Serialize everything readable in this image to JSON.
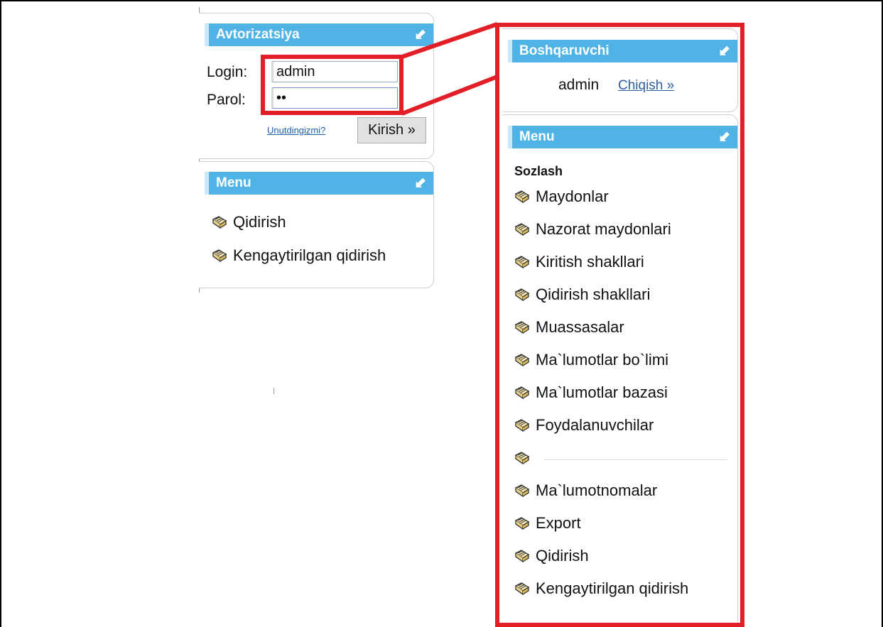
{
  "auth_panel": {
    "title": "Avtorizatsiya",
    "login_label": "Login:",
    "login_value": "admin",
    "password_label": "Parol:",
    "password_value": "••",
    "forgot_link": "Unutdingizmi?",
    "submit_label": "Kirish »"
  },
  "left_menu": {
    "title": "Menu",
    "items": [
      {
        "label": "Qidirish"
      },
      {
        "label": "Kengaytirilgan qidirish"
      }
    ]
  },
  "admin_panel": {
    "title": "Boshqaruvchi",
    "username": "admin",
    "logout_link": "Chiqish »"
  },
  "right_menu": {
    "title": "Menu",
    "section_title": "Sozlash",
    "items": [
      {
        "label": "Maydonlar"
      },
      {
        "label": "Nazorat maydonlari"
      },
      {
        "label": "Kiritish shakllari"
      },
      {
        "label": "Qidirish shakllari"
      },
      {
        "label": "Muassasalar"
      },
      {
        "label": "Ma`lumotlar bo`limi"
      },
      {
        "label": "Ma`lumotlar bazasi"
      },
      {
        "label": "Foydalanuvchilar"
      },
      {
        "label": ""
      },
      {
        "label": "Ma`lumotnomalar"
      },
      {
        "label": "Export"
      },
      {
        "label": "Qidirish"
      },
      {
        "label": "Kengaytirilgan qidirish"
      }
    ]
  },
  "colors": {
    "panel_header": "#4fb3e6",
    "highlight": "#e21f26",
    "link": "#1e5fa8"
  },
  "icons": {
    "collapse": "collapse-arrow-icon",
    "menu_item": "book-icon"
  }
}
